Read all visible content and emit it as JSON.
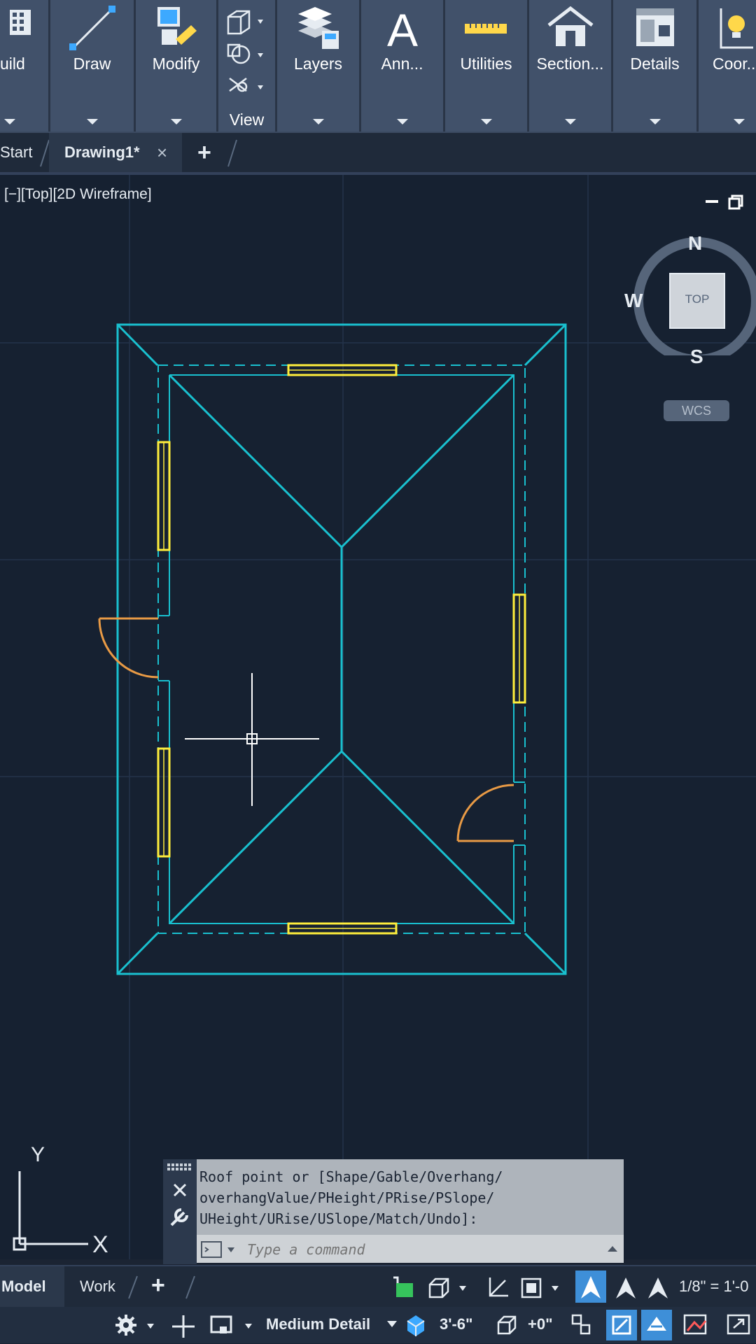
{
  "ribbon": {
    "panels": [
      {
        "label": "uild"
      },
      {
        "label": "Draw"
      },
      {
        "label": "Modify"
      },
      {
        "label": "View"
      },
      {
        "label": "Layers"
      },
      {
        "label": "Ann..."
      },
      {
        "label": "Utilities"
      },
      {
        "label": "Section..."
      },
      {
        "label": "Details"
      },
      {
        "label": "Coor..."
      }
    ]
  },
  "tabs": {
    "start": "Start",
    "active": "Drawing1*",
    "close_glyph": "×",
    "new_glyph": "+"
  },
  "viewport": {
    "label": "[−][Top][2D Wireframe]",
    "viewcube": {
      "n": "N",
      "s": "S",
      "w": "W",
      "top": "TOP",
      "wcs": "WCS"
    },
    "ucs": {
      "x": "X",
      "y": "Y"
    },
    "colors": {
      "wall": "#19c0cf",
      "window": "#ffee3c",
      "door": "#e89a45",
      "background": "#162131"
    }
  },
  "command": {
    "history": "Roof point or [Shape/Gable/Overhang/\noverhangValue/PHeight/PRise/PSlope/\nUHeight/URise/USlope/Match/Undo]:",
    "placeholder": "Type a command"
  },
  "status": {
    "layout_tabs": [
      "Model",
      "Work"
    ],
    "scale": "1/8\" = 1'-0",
    "detail_level": "Medium Detail",
    "elevation": "3'-6\"",
    "offset": "+0\""
  }
}
